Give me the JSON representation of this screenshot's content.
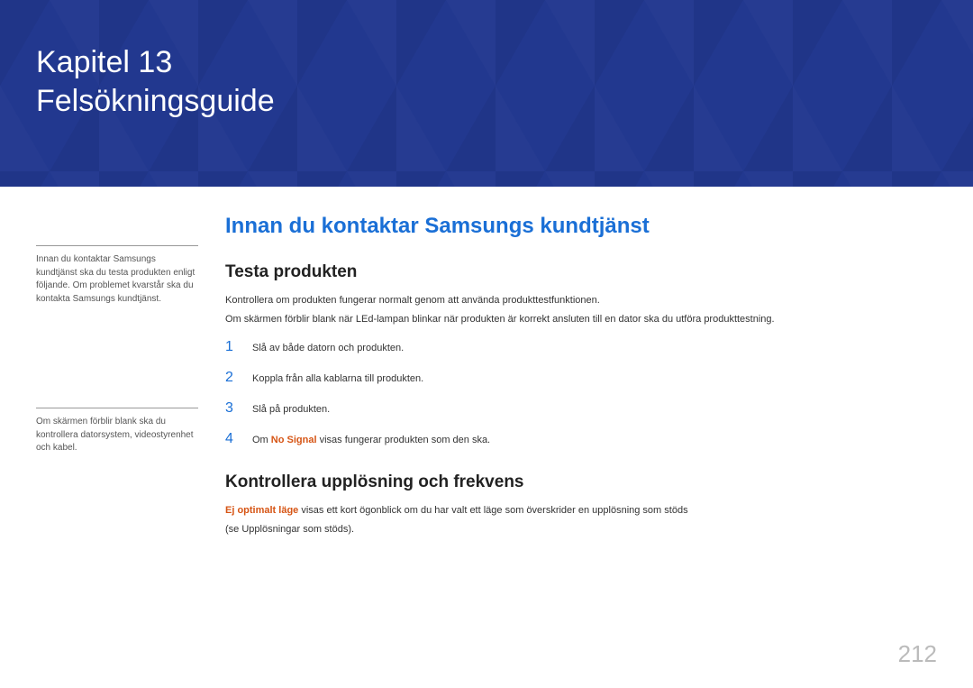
{
  "banner": {
    "chapter": "Kapitel 13",
    "title": "Felsökningsguide"
  },
  "sidebar": {
    "note1": "Innan du kontaktar Samsungs kundtjänst ska du testa produkten enligt följande. Om problemet kvarstår ska du kontakta Samsungs kundtjänst.",
    "note2": "Om skärmen förblir blank ska du kontrollera datorsystem, videostyrenhet och kabel."
  },
  "main": {
    "heading": "Innan du kontaktar Samsungs kundtjänst",
    "section1": {
      "title": "Testa produkten",
      "p1": "Kontrollera om produkten fungerar normalt genom att använda produkttestfunktionen.",
      "p2": "Om skärmen förblir blank när LEd-lampan blinkar när produkten är korrekt ansluten till en dator ska du utföra produkttestning.",
      "steps": [
        {
          "n": "1",
          "text": "Slå av både datorn och produkten."
        },
        {
          "n": "2",
          "text": "Koppla från alla kablarna till produkten."
        },
        {
          "n": "3",
          "text": "Slå på produkten."
        },
        {
          "n": "4",
          "prefix": "Om ",
          "bold": "No Signal",
          "suffix": " visas fungerar produkten som den ska."
        }
      ]
    },
    "section2": {
      "title": "Kontrollera upplösning och frekvens",
      "bold": "Ej optimalt läge",
      "rest": " visas ett kort ögonblick om du har valt ett läge som överskrider en upplösning som stöds",
      "p2": "(se Upplösningar som stöds)."
    }
  },
  "page": "212"
}
